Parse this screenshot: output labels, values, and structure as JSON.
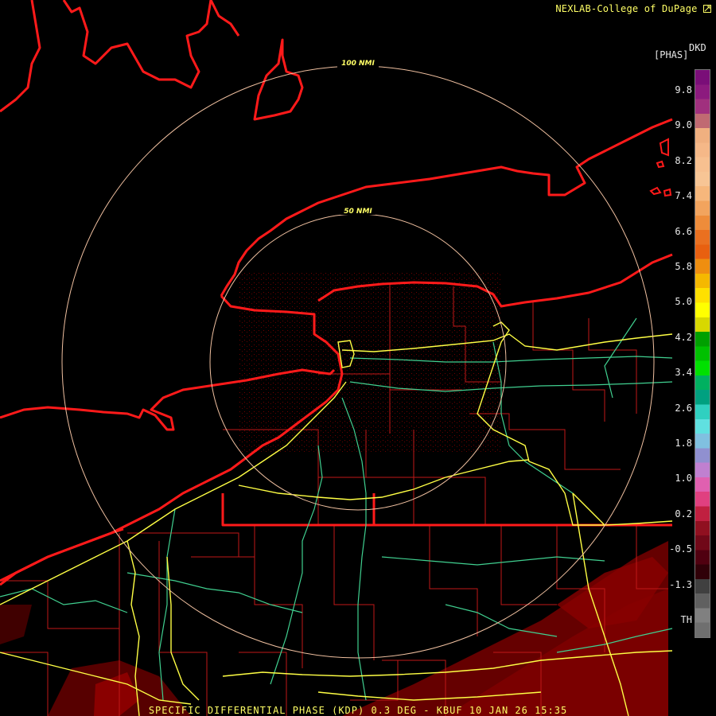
{
  "header": {
    "credit": "NEXLAB-College of DuPage",
    "logo_icon": "cod-logo-icon"
  },
  "footer": {
    "caption": "SPECIFIC DIFFERENTIAL PHASE (KDP) 0.3 DEG - KBUF 10 JAN 26 15:35"
  },
  "legend": {
    "product": "DKD",
    "units": "[PHAS]",
    "ticks": [
      "9.8",
      "9.0",
      "8.2",
      "7.4",
      "6.6",
      "5.8",
      "5.0",
      "4.2",
      "3.4",
      "2.6",
      "1.8",
      "1.0",
      "0.2",
      "-0.5",
      "-1.3",
      "TH"
    ],
    "colors": [
      "#7a0e78",
      "#8c1a7e",
      "#a0307e",
      "#c06a72",
      "#f0b080",
      "#f5b888",
      "#f7c090",
      "#f7c595",
      "#f6b77c",
      "#f2a45e",
      "#ee8c3a",
      "#ea7020",
      "#e86010",
      "#ef8e10",
      "#f5b800",
      "#ffe000",
      "#ffff00",
      "#d8d800",
      "#00a000",
      "#00c000",
      "#00e000",
      "#00b060",
      "#00a080",
      "#30d0c0",
      "#60e0e0",
      "#80c0e0",
      "#9090d0",
      "#c080d0",
      "#e060b0",
      "#e04080",
      "#c02040",
      "#901020",
      "#700818",
      "#500010",
      "#300008",
      "#404040",
      "#606060",
      "#808080",
      "#6f6f6f"
    ]
  },
  "rings": [
    {
      "label": "50 NMI"
    },
    {
      "label": "100 NMI"
    }
  ],
  "colors": {
    "coast": "#ff1a1a",
    "county": "#c01818",
    "interstate": "#ffff44",
    "highway": "#40d090",
    "ring": "#f0c0a0",
    "echo": "#700000"
  }
}
